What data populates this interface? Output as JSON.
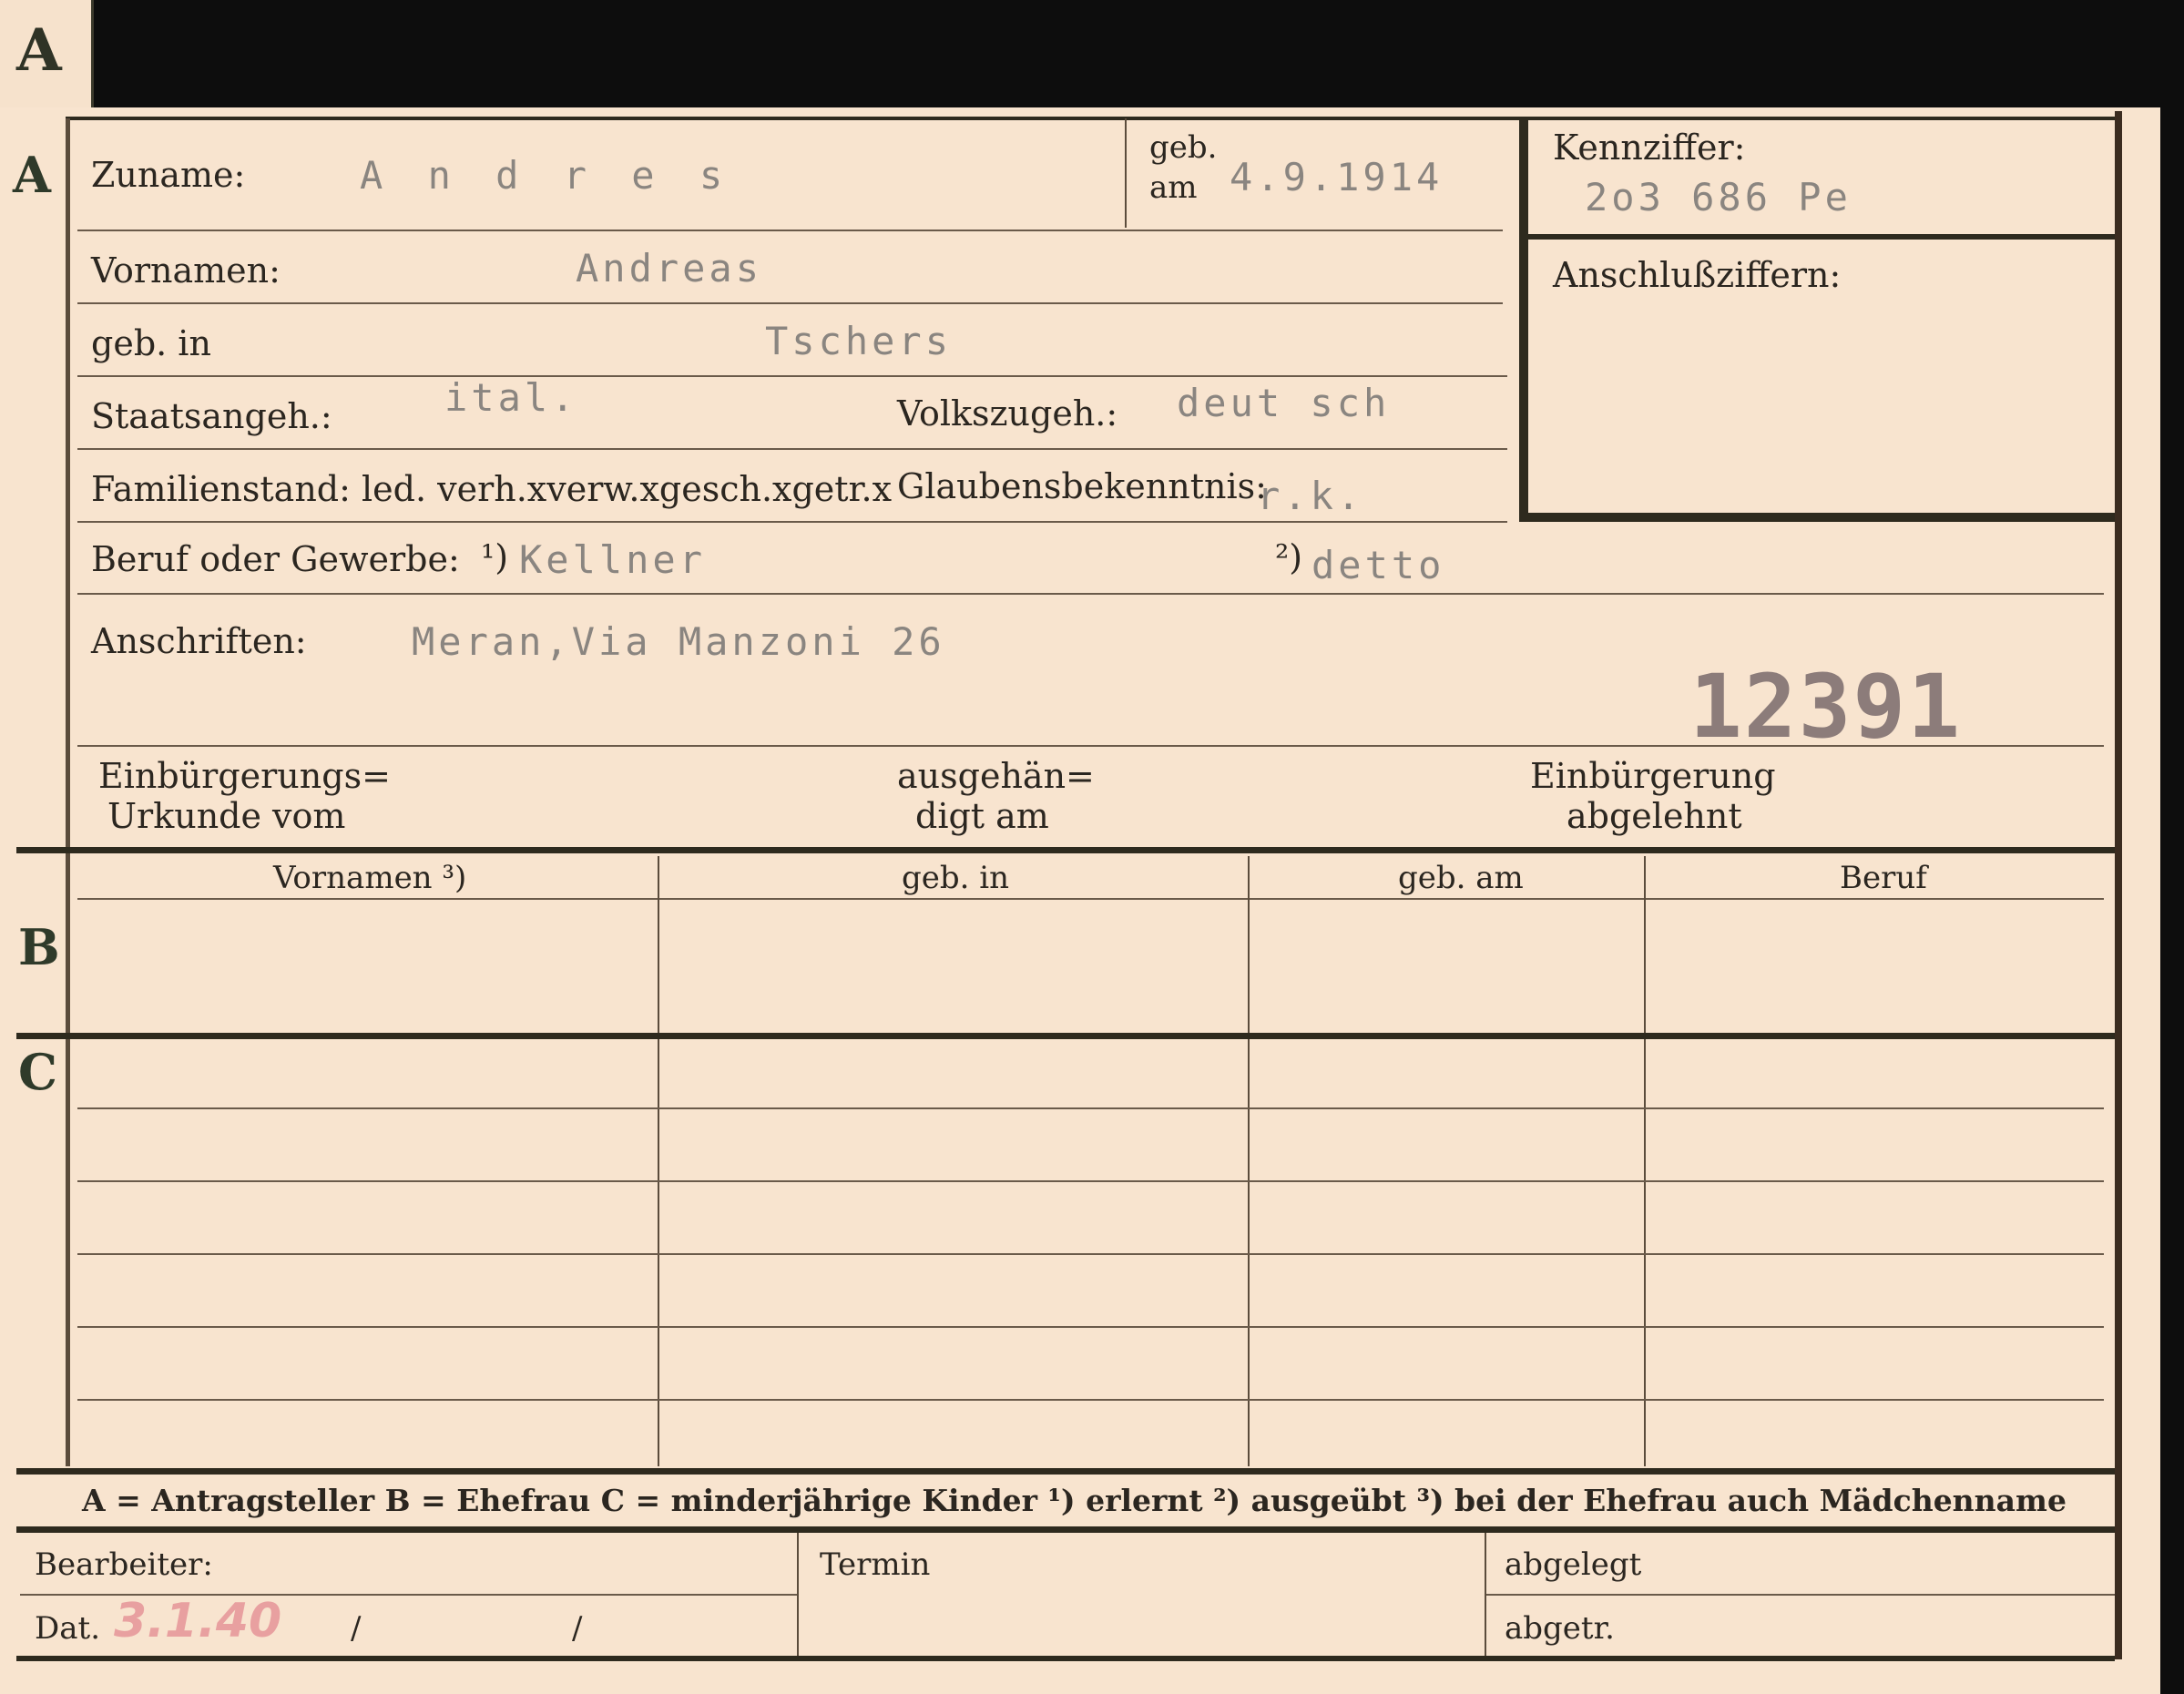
{
  "tab": {
    "letter": "A"
  },
  "section_letters": {
    "a": "A",
    "b": "B",
    "c": "C"
  },
  "section_a": {
    "zuname_label": "Zuname:",
    "zuname_value": "A n d r e s",
    "geb_am_label_1": "geb.",
    "geb_am_label_2": "am",
    "geb_am_value": "4.9.1914",
    "kennziffer_label": "Kennziffer:",
    "kennziffer_value": "2o3 686 Pe",
    "anschlussziffern_label": "Anschlußziffern:",
    "vornamen_label": "Vornamen:",
    "vornamen_value": "Andreas",
    "geb_in_label": "geb. in",
    "geb_in_value": "Tschers",
    "staatsangeh_label": "Staatsangeh.:",
    "staatsangeh_value": "ital.",
    "volkszugeh_label": "Volkszugeh.:",
    "volkszugeh_value": "deut sch",
    "familienstand_label": "Familienstand: led. verh.xverw.xgesch.xgetr.x",
    "glaubens_label": "Glaubensbekenntnis:",
    "glaubens_value": "r.k.",
    "beruf_label": "Beruf oder Gewerbe:",
    "beruf_marker_1": "¹)",
    "beruf_value_1": "Kellner",
    "beruf_marker_2": "²)",
    "beruf_value_2": "detto",
    "anschriften_label": "Anschriften:",
    "anschriften_value": "Meran,Via Manzoni 26",
    "stamp_number": "12391",
    "einbuergerungs_label_1": "Einbürgerungs=",
    "einbuergerungs_label_2": "Urkunde vom",
    "ausgehaendigt_label_1": "ausgehän=",
    "ausgehaendigt_label_2": "digt am",
    "abgelehnt_label_1": "Einbürgerung",
    "abgelehnt_label_2": "abgelehnt"
  },
  "table": {
    "headers": [
      "Vornamen ³)",
      "geb. in",
      "geb. am",
      "Beruf"
    ]
  },
  "legend": {
    "text": "A = Antragsteller   B = Ehefrau   C = minderjährige Kinder   ¹) erlernt   ²) ausgeübt   ³) bei der Ehefrau auch Mädchenname"
  },
  "footer": {
    "bearbeiter_label": "Bearbeiter:",
    "termin_label": "Termin",
    "abgelegt_label": "abgelegt",
    "dat_label": "Dat.",
    "dat_value": "3.1.40",
    "slash_1": "/",
    "slash_2": "/",
    "abgetr_label": "abgetr."
  },
  "colors": {
    "paper": "#f8e4cf",
    "ink": "#2b2620",
    "typewriter": "#8a8580",
    "stamp_red": "#e8a0a0"
  }
}
